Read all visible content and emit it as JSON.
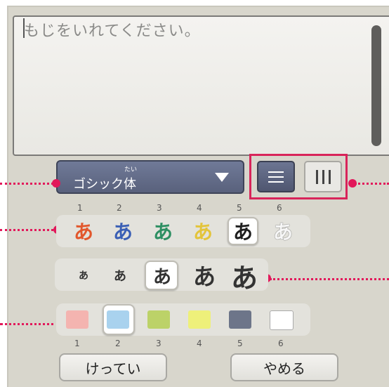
{
  "textarea": {
    "placeholder": "もじをいれてください。"
  },
  "font": {
    "name": "ゴシック体",
    "ruby": "たい"
  },
  "orientation": {
    "selected": "horizontal"
  },
  "color_style": {
    "numbers": [
      "1",
      "2",
      "3",
      "4",
      "5",
      "6"
    ],
    "glyph": "あ",
    "selected_index": 5,
    "colors": [
      "#e2572c",
      "#3a5fb5",
      "#2d8f62",
      "#e3c43a",
      "#1e1e1e",
      "#f7f7f7"
    ]
  },
  "size": {
    "glyph": "あ",
    "selected_index": 3,
    "count": 5
  },
  "paper": {
    "numbers": [
      "1",
      "2",
      "3",
      "4",
      "5",
      "6"
    ],
    "selected_index": 2,
    "colors": [
      "#f4b4b0",
      "#a9d2ee",
      "#bcd268",
      "#eef07a",
      "#6d7589",
      "#ffffff"
    ]
  },
  "buttons": {
    "ok": "けってい",
    "cancel": "やめる"
  }
}
